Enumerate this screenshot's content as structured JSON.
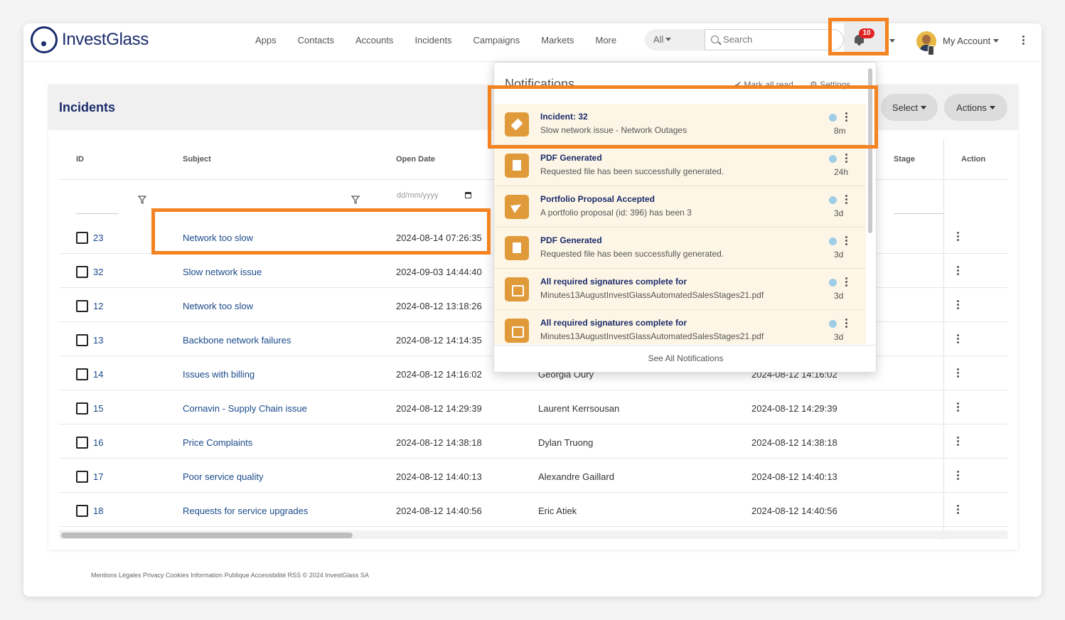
{
  "app": {
    "logo_text": "InvestGlass",
    "nav": [
      "Apps",
      "Contacts",
      "Accounts",
      "Incidents",
      "Campaigns",
      "Markets",
      "More"
    ],
    "search_scope": "All",
    "search_placeholder": "Search",
    "notification_count": "10",
    "account_label": "My Account"
  },
  "page": {
    "title": "Incidents",
    "select_label": "Select",
    "actions_label": "Actions",
    "columns": {
      "id": "ID",
      "subject": "Subject",
      "open_date": "Open Date",
      "stage": "Stage",
      "action": "Action"
    },
    "date_placeholder": "dd/mm/yyyy",
    "rows": [
      {
        "id": "23",
        "subject": "Network too slow",
        "open_date": "2024-08-14 07:26:35",
        "owner": "",
        "updated": ""
      },
      {
        "id": "32",
        "subject": "Slow network issue",
        "open_date": "2024-09-03 14:44:40",
        "owner": "",
        "updated": ""
      },
      {
        "id": "12",
        "subject": "Network too slow",
        "open_date": "2024-08-12 13:18:26",
        "owner": "",
        "updated": ""
      },
      {
        "id": "13",
        "subject": "Backbone network failures",
        "open_date": "2024-08-12 14:14:35",
        "owner": "",
        "updated": ""
      },
      {
        "id": "14",
        "subject": "Issues with billing",
        "open_date": "2024-08-12 14:16:02",
        "owner": "Georgia Oury",
        "updated": "2024-08-12 14:16:02"
      },
      {
        "id": "15",
        "subject": "Cornavin - Supply Chain issue",
        "open_date": "2024-08-12 14:29:39",
        "owner": "Laurent Kerrsousan",
        "updated": "2024-08-12 14:29:39"
      },
      {
        "id": "16",
        "subject": "Price Complaints",
        "open_date": "2024-08-12 14:38:18",
        "owner": "Dylan Truong",
        "updated": "2024-08-12 14:38:18"
      },
      {
        "id": "17",
        "subject": "Poor service quality",
        "open_date": "2024-08-12 14:40:13",
        "owner": "Alexandre Gaillard",
        "updated": "2024-08-12 14:40:13"
      },
      {
        "id": "18",
        "subject": "Requests for service upgrades",
        "open_date": "2024-08-12 14:40:56",
        "owner": "Eric Atiek",
        "updated": "2024-08-12 14:40:56"
      }
    ],
    "footer": "Mentions Légales Privacy Cookies Information Publique Accessibilité RSS © 2024 InvestGlass SA"
  },
  "notifications": {
    "title": "Notifications",
    "mark_all_read": "Mark all read",
    "settings": "Settings",
    "see_all": "See All Notifications",
    "items": [
      {
        "icon": "ticket-icon",
        "title": "Incident: 32",
        "desc": "Slow network issue - Network Outages",
        "time": "8m"
      },
      {
        "icon": "file-icon",
        "title": "PDF Generated",
        "desc": "Requested file has been successfully generated.",
        "time": "24h"
      },
      {
        "icon": "send-icon",
        "title": "Portfolio Proposal Accepted",
        "desc": "A portfolio proposal (id: 396) has been 3",
        "time": "3d"
      },
      {
        "icon": "file-icon",
        "title": "PDF Generated",
        "desc": "Requested file has been successfully generated.",
        "time": "3d"
      },
      {
        "icon": "signature-icon",
        "title": "All required signatures complete for",
        "desc": "Minutes13AugustInvestGlassAutomatedSalesStages21.pdf",
        "time": "3d"
      },
      {
        "icon": "signature-icon",
        "title": "All required signatures complete for",
        "desc": "Minutes13AugustInvestGlassAutomatedSalesStages21.pdf",
        "time": "3d"
      }
    ]
  },
  "colors": {
    "brand": "#1a2b6b",
    "highlight": "#f58220",
    "badge": "#e02424",
    "notif_icon": "#e09a3a"
  }
}
